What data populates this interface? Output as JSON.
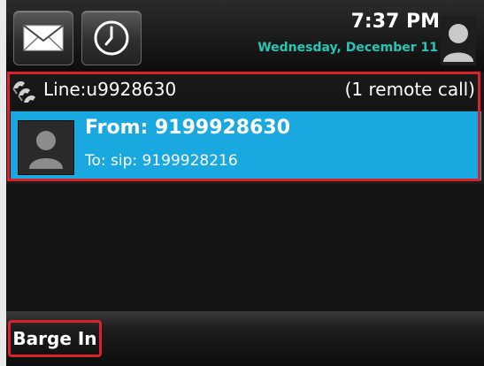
{
  "status_bar": {
    "icons": [
      "mail-icon",
      "clock-icon",
      "user-icon"
    ],
    "time": "7:37 PM",
    "date": "Wednesday, December 11"
  },
  "line": {
    "icon": "shared-line-icon",
    "label": "Line:u9928630",
    "remote_calls": "(1 remote call)"
  },
  "call": {
    "from": "From: 9199928630",
    "to": "To: sip: 9199928216",
    "avatar_icon": "user-icon"
  },
  "softkeys": {
    "barge_in": "Barge In"
  },
  "colors": {
    "selection": "#1aa8e0",
    "date": "#27c6b6",
    "highlight": "#d8232a"
  }
}
